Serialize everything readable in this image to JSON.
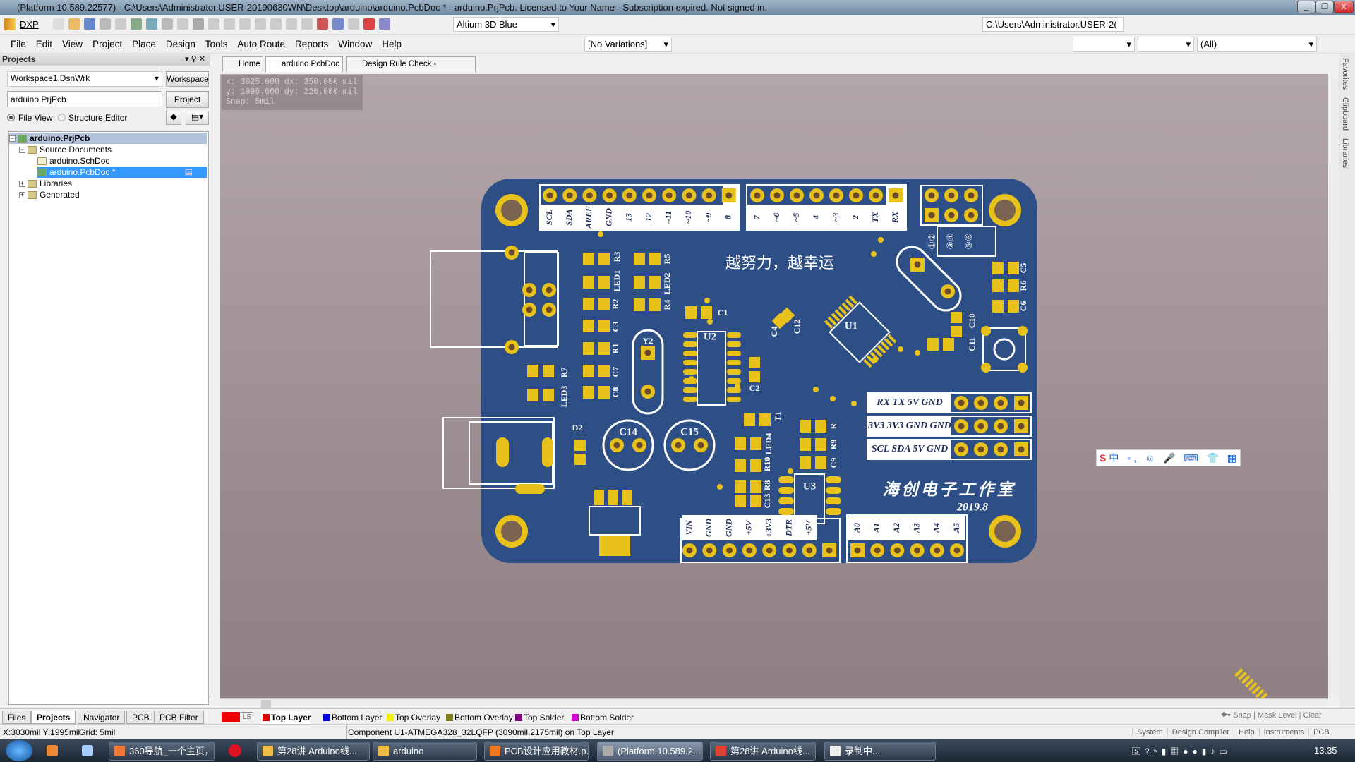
{
  "title": "(Platform 10.589.22577) - C:\\Users\\Administrator.USER-20190630WN\\Desktop\\arduino\\arduino.PcbDoc * - arduino.PrjPcb. Licensed to Your Name - Subscription expired. Not signed in.",
  "toolbar": {
    "dxp": "DXP",
    "theme": "Altium 3D Blue",
    "path": "C:\\Users\\Administrator.USER-2(",
    "variations": "[No Variations]",
    "filter_all": "(All)"
  },
  "menu": [
    "File",
    "Edit",
    "View",
    "Project",
    "Place",
    "Design",
    "Tools",
    "Auto Route",
    "Reports",
    "Window",
    "Help"
  ],
  "panel": {
    "title": "Projects",
    "workspace": "Workspace1.DsnWrk",
    "workspace_btn": "Workspace",
    "project": "arduino.PrjPcb",
    "project_btn": "Project",
    "file_view": "File View",
    "structure_editor": "Structure Editor",
    "tree": [
      "arduino.PrjPcb",
      "Source Documents",
      "arduino.SchDoc",
      "arduino.PcbDoc *",
      "Libraries",
      "Generated"
    ],
    "bottom_tabs": [
      "Files",
      "Projects",
      "Navigator",
      "PCB",
      "PCB Filter"
    ]
  },
  "doc_tabs": [
    "Home",
    "arduino.PcbDoc *",
    "Design Rule Check - arduino.html"
  ],
  "right_panels": [
    "Favorites",
    "Clipboard",
    "Libraries"
  ],
  "coord_overlay": [
    "x: 3025.000  dx: 350.000 mil",
    "y: 1995.000  dy: 220.000 mil",
    "Snap: 5mil"
  ],
  "pcb": {
    "slogan": "越努力，越幸运",
    "studio": "海创电子工作室",
    "date": "2019.8",
    "digital_high": [
      "SCL",
      "SDA",
      "AREF",
      "GND",
      "13",
      "12",
      "~11",
      "~10",
      "~9",
      "8"
    ],
    "digital_low": [
      "7",
      "~6",
      "~5",
      "4",
      "~3",
      "2",
      "TX",
      "RX"
    ],
    "icsp": [
      "①②",
      "③④",
      "⑤⑥"
    ],
    "side_headers": [
      "RX TX 5V GND",
      "3V3 3V3 GND GND",
      "SCL SDA 5V GND"
    ],
    "power": [
      "VIN",
      "GND",
      "GND",
      "+5V",
      "+3V3",
      "DTR",
      "+5V",
      ""
    ],
    "analog": [
      "A0",
      "A1",
      "A2",
      "A3",
      "A4",
      "A5"
    ],
    "designators": [
      "R3",
      "R5",
      "LED1",
      "LED2",
      "R2",
      "R4",
      "R1",
      "C3",
      "C7",
      "C8",
      "R7",
      "LED3",
      "C1",
      "U2",
      "C2",
      "Y2",
      "C4",
      "C12",
      "U1",
      "C10",
      "C11",
      "C5",
      "R6",
      "C6",
      "D2",
      "C14",
      "C15",
      "T1",
      "LED4",
      "R10",
      "R8",
      "C13",
      "U3",
      "R",
      "R9",
      "C9"
    ],
    "colors": {
      "board": "#2d4f86",
      "pad": "#e8c21a",
      "silk": "#ffffff"
    }
  },
  "layers": {
    "current": "LS",
    "tabs": [
      {
        "name": "Top Layer",
        "color": "#e00000"
      },
      {
        "name": "Bottom Layer",
        "color": "#0000e0"
      },
      {
        "name": "Top Overlay",
        "color": "#f0f000"
      },
      {
        "name": "Bottom Overlay",
        "color": "#808020"
      },
      {
        "name": "Top Solder",
        "color": "#800080"
      },
      {
        "name": "Bottom Solder",
        "color": "#d000d0"
      }
    ],
    "right": [
      "Snap",
      "Mask Level",
      "Clear"
    ]
  },
  "status": {
    "coords": "X:3030mil Y:1995mil",
    "grid": "Grid: 5mil",
    "component": "Component U1-ATMEGA328_32LQFP (3090mil,2175mil) on Top Layer",
    "panels": [
      "System",
      "Design Compiler",
      "Help",
      "Instruments",
      "PCB"
    ]
  },
  "ime": "中 ◦, ☺ 🎤 ⌨ 👕 ▦",
  "taskbar": {
    "items": [
      "360导航_一个主页，...",
      "第28讲 Arduino线...",
      "arduino",
      "PCB设计应用教材.p...",
      "(Platform 10.589.2...",
      "第28讲 Arduino线...",
      "录制中..."
    ],
    "clock": "13:35"
  }
}
